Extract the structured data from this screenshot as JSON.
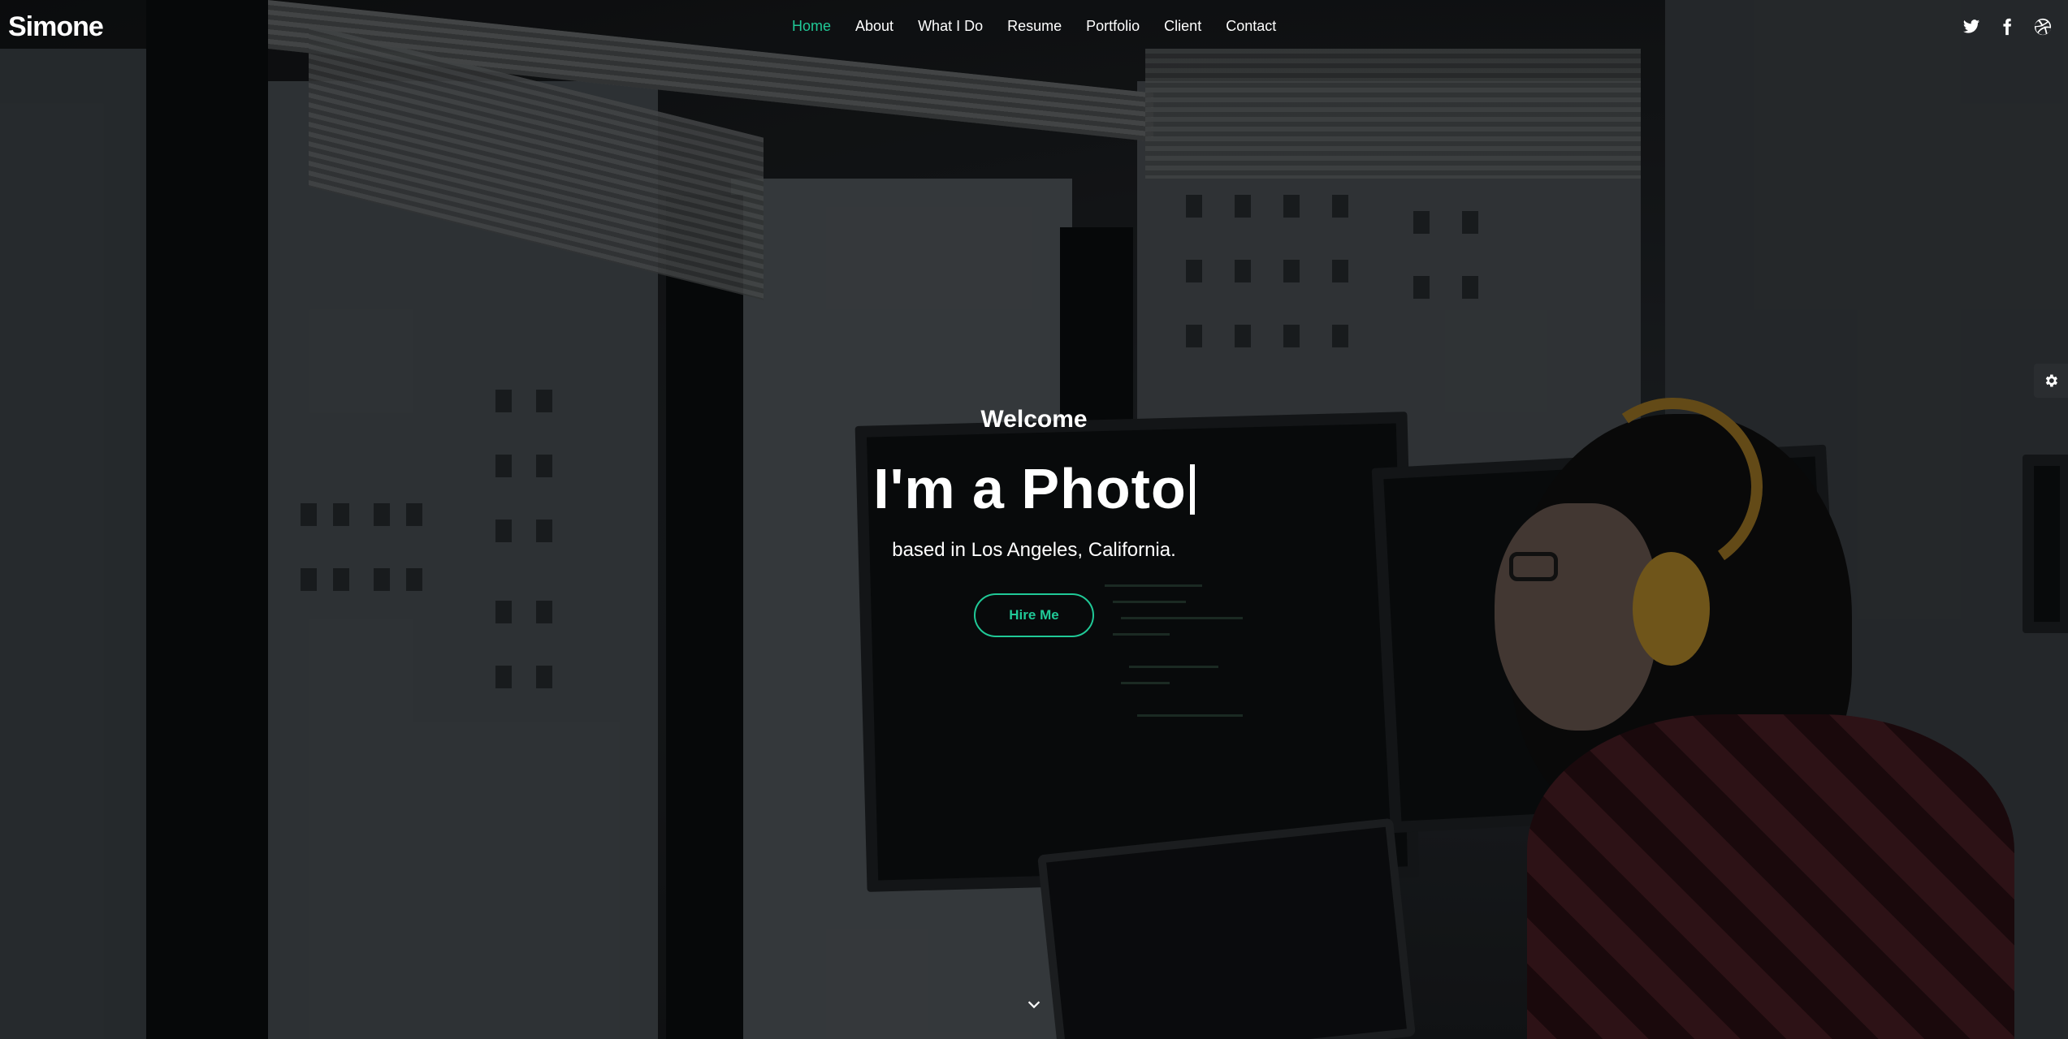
{
  "brand": {
    "logo": "Simone"
  },
  "nav": {
    "items": [
      {
        "label": "Home",
        "active": true
      },
      {
        "label": "About"
      },
      {
        "label": "What I Do"
      },
      {
        "label": "Resume"
      },
      {
        "label": "Portfolio"
      },
      {
        "label": "Client"
      },
      {
        "label": "Contact"
      }
    ]
  },
  "social": {
    "icons": [
      "twitter-icon",
      "facebook-icon",
      "dribbble-icon"
    ]
  },
  "hero": {
    "welcome": "Welcome",
    "headline": "I'm a Photo",
    "subline": "based in Los Angeles, California.",
    "cta": "Hire Me"
  },
  "colors": {
    "accent": "#20c997",
    "text": "#ffffff"
  }
}
